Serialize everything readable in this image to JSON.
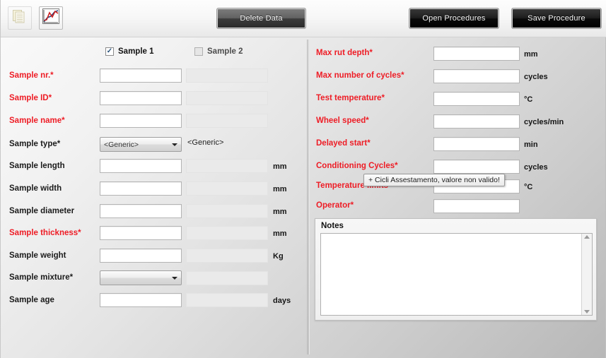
{
  "toolbar": {
    "copy_icon_name": "copy-pages-icon",
    "chart_icon_name": "chart-curve-icon",
    "delete_label": "Delete Data",
    "open_label": "Open Procedures",
    "save_label": "Save Procedure"
  },
  "samples": {
    "sample1": {
      "label": "Sample 1",
      "checked": true
    },
    "sample2": {
      "label": "Sample 2",
      "checked": false
    }
  },
  "left_form": {
    "rows": [
      {
        "label": "Sample nr.*",
        "required": true,
        "type": "text",
        "value": "",
        "value2": "",
        "unit": ""
      },
      {
        "label": "Sample ID*",
        "required": true,
        "type": "text",
        "value": "",
        "value2": "",
        "unit": ""
      },
      {
        "label": "Sample name*",
        "required": true,
        "type": "text",
        "value": "",
        "value2": "",
        "unit": ""
      },
      {
        "label": "Sample type*",
        "required": false,
        "type": "combo",
        "value": "<Generic>",
        "value2": "<Generic>",
        "unit": ""
      },
      {
        "label": "Sample length",
        "required": false,
        "type": "text",
        "value": "",
        "value2": "",
        "unit": "mm"
      },
      {
        "label": "Sample width",
        "required": false,
        "type": "text",
        "value": "",
        "value2": "",
        "unit": "mm"
      },
      {
        "label": "Sample diameter",
        "required": false,
        "type": "text",
        "value": "",
        "value2": "",
        "unit": "mm"
      },
      {
        "label": "Sample thickness*",
        "required": true,
        "type": "text",
        "value": "",
        "value2": "",
        "unit": "mm"
      },
      {
        "label": "Sample weight",
        "required": false,
        "type": "text",
        "value": "",
        "value2": "",
        "unit": "Kg"
      },
      {
        "label": "Sample mixture*",
        "required": false,
        "type": "combo",
        "value": "",
        "value2": "",
        "unit": ""
      },
      {
        "label": "Sample age",
        "required": false,
        "type": "text",
        "value": "",
        "value2": "",
        "unit": "days"
      }
    ]
  },
  "right_form": {
    "rows": [
      {
        "label": "Max rut depth*",
        "value": "",
        "unit": "mm"
      },
      {
        "label": "Max number of cycles*",
        "value": "",
        "unit": "cycles"
      },
      {
        "label": "Test temperature*",
        "value": "",
        "unit": "°C"
      },
      {
        "label": "Wheel speed*",
        "value": "",
        "unit": "cycles/min"
      },
      {
        "label": "Delayed start*",
        "value": "",
        "unit": "min"
      },
      {
        "label": "Conditioning Cycles*",
        "value": "",
        "unit": "cycles"
      },
      {
        "label": "Temperature limits",
        "value": "",
        "unit": "°C"
      },
      {
        "label": "Operator*",
        "value": "",
        "unit": ""
      }
    ]
  },
  "notes": {
    "title": "Notes",
    "value": "",
    "placeholder": ""
  },
  "tooltip": {
    "text": "+ Cicli Assestamento, valore non valido!"
  },
  "colors": {
    "required_red": "#ee1c25",
    "label_black": "#1b1b1b",
    "button_dark": "#000000",
    "panel_bg": "#efefef"
  }
}
